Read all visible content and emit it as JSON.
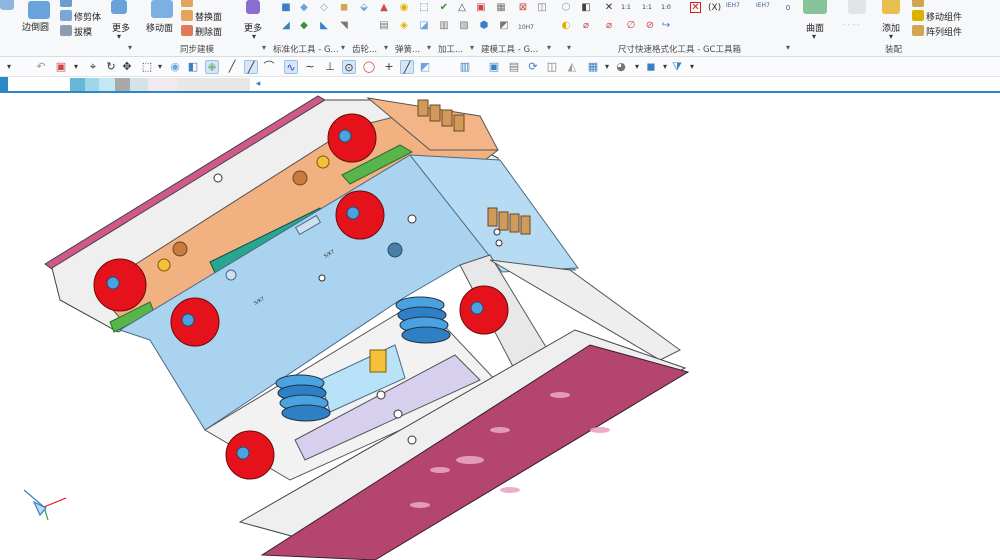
{
  "ribbon": {
    "left_labels": {
      "edge_face": "边倒圆",
      "trim_body": "修剪体",
      "draft": "拔模",
      "more_1": "更多",
      "move_face": "移动面",
      "replace_face": "替换面",
      "delete_face": "删除面",
      "more_2": "更多",
      "surface": "曲面",
      "add": "添加",
      "move_component": "移动组件",
      "array_component": "阵列组件"
    },
    "group_labels": {
      "sync_modeling": "同步建模",
      "std_tools": "标准化工具 - G...",
      "gear": "齿轮...",
      "spring": "弹簧...",
      "machining": "加工...",
      "mold_tools": "建模工具 - G...",
      "dim_tools": "尺寸快速格式化工具 - GC工具箱",
      "assembly": "装配"
    },
    "small_texts": {
      "h7_1": "IEH7",
      "h7_2": "IEH7",
      "ten_h7": "10H7"
    }
  },
  "viewport": {
    "labels": {
      "plate_mark_1": "S/K7",
      "plate_mark_2": "S/K7"
    }
  },
  "colors": {
    "accent": "#2b87c8",
    "plate_blue": "#a9d3ef",
    "plate_orange": "#f2b181",
    "plate_pink": "#b3456f",
    "plate_green": "#2aa58f",
    "grey_plate": "#e8e8e8",
    "red_part": "#e5121b",
    "cyan_part": "#4aa3e0",
    "purple_plate": "#d6d0ee"
  }
}
